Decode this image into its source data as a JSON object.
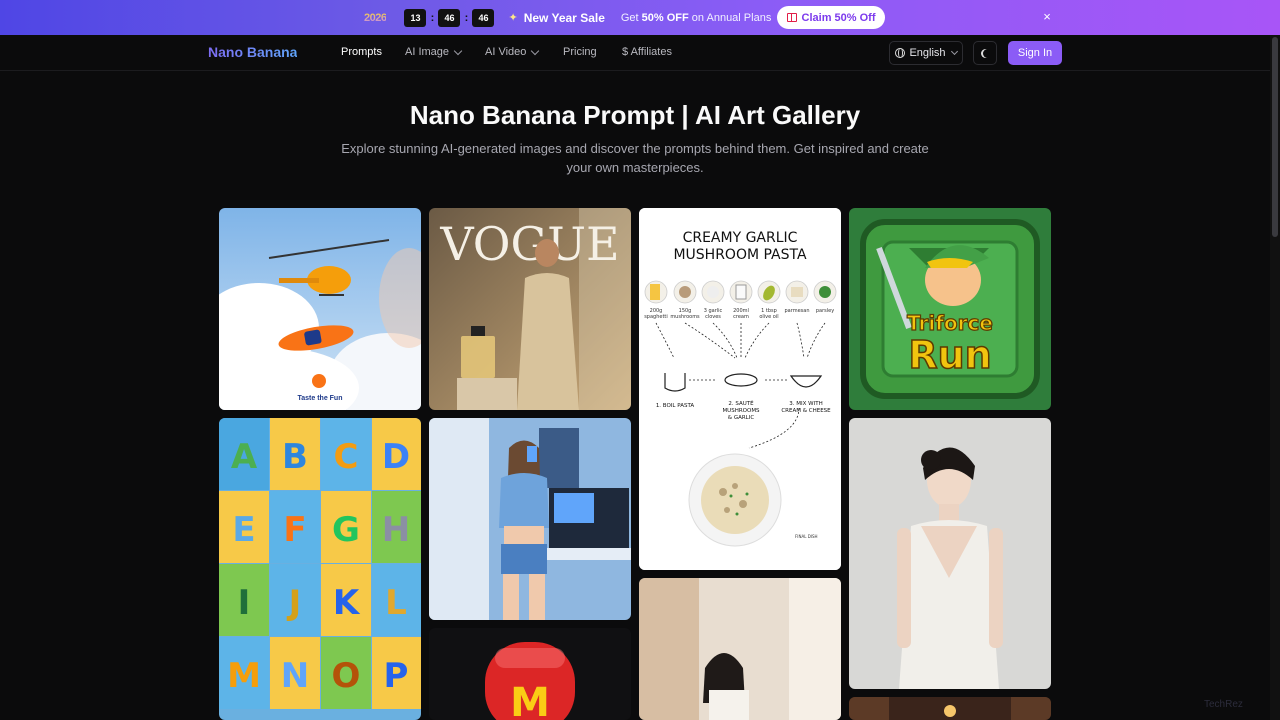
{
  "promo": {
    "year_logo": "2026",
    "timer": {
      "hours": "13",
      "minutes": "46",
      "seconds": "46"
    },
    "sale_title": "New Year Sale",
    "sale_text_prefix": "Get ",
    "sale_text_bold": "50% OFF",
    "sale_text_suffix": " on Annual Plans",
    "claim_label": "Claim 50% Off",
    "close_icon": "×"
  },
  "nav": {
    "brand": "Nano Banana",
    "items": [
      {
        "label": "Prompts",
        "active": true
      },
      {
        "label": "AI Image",
        "dropdown": true
      },
      {
        "label": "AI Video",
        "dropdown": true
      },
      {
        "label": "Pricing"
      },
      {
        "label": "$ Affiliates"
      }
    ],
    "language": "English",
    "signin": "Sign In"
  },
  "hero": {
    "title": "Nano Banana Prompt | AI Art Gallery",
    "subtitle": "Explore stunning AI-generated images and discover the prompts behind them. Get inspired and create your own masterpieces."
  },
  "gallery": {
    "cards": [
      {
        "name": "helicopter-fanta",
        "caption": "Taste the Fun"
      },
      {
        "name": "vogue-perfume",
        "caption": "VOGUE"
      },
      {
        "name": "recipe-pasta",
        "caption": "CREAMY GARLIC MUSHROOM PASTA",
        "ingredients": [
          "200g spaghetti",
          "150g mushrooms",
          "3 garlic cloves",
          "200ml cream",
          "1 tbsp olive oil",
          "parmesan",
          "parsley"
        ],
        "steps": [
          "1. BOIL PASTA",
          "2. SAUTÉ MUSHROOMS & GARLIC",
          "3. MIX WITH CREAM & CHEESE"
        ],
        "final": "FINAL DISH"
      },
      {
        "name": "triforce-run",
        "caption": "Triforce Run"
      },
      {
        "name": "alphabet-animals",
        "caption": "ABCDEFGHIJKLMNOP"
      },
      {
        "name": "selfie-room",
        "caption": ""
      },
      {
        "name": "mcdonalds-capsule",
        "caption": ""
      },
      {
        "name": "woman-portrait",
        "caption": ""
      },
      {
        "name": "bride-portrait",
        "caption": ""
      }
    ]
  },
  "colors": {
    "accent": "#8b5cf6",
    "background": "#0b0b0c",
    "promo_start": "#4f46e5",
    "promo_end": "#a855f7"
  },
  "watermark": "TechRez"
}
